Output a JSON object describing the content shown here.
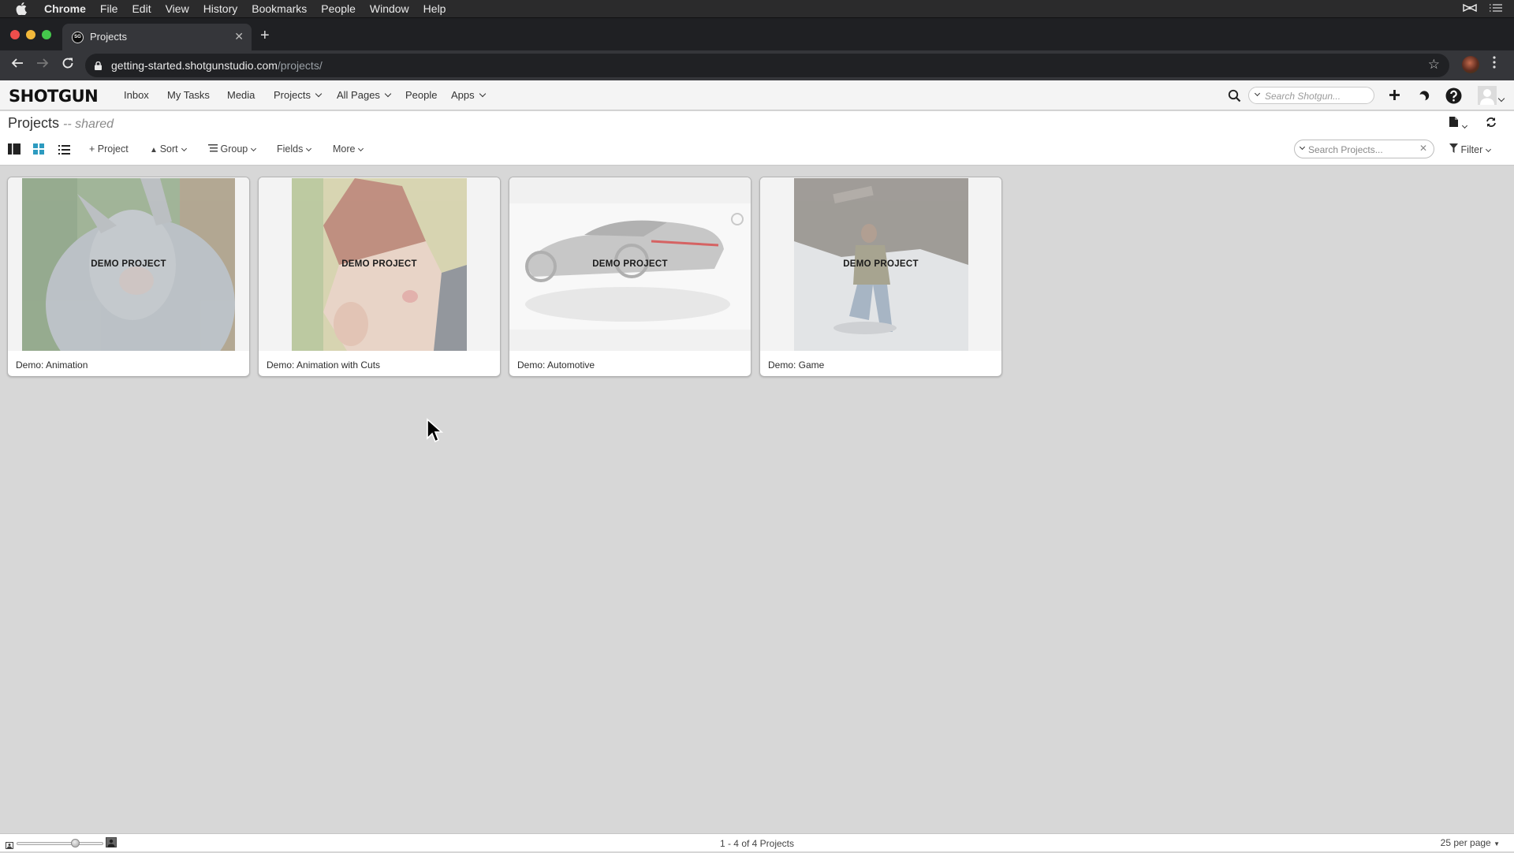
{
  "mac_menu": {
    "app_name": "Chrome",
    "items": [
      "File",
      "Edit",
      "View",
      "History",
      "Bookmarks",
      "People",
      "Window",
      "Help"
    ]
  },
  "browser": {
    "tab_title": "Projects",
    "favicon_text": "SG",
    "url_host": "getting-started.shotgunstudio.com",
    "url_path": "/projects/"
  },
  "header": {
    "logo": "SHOTGUN",
    "nav": [
      {
        "label": "Inbox",
        "dropdown": false
      },
      {
        "label": "My Tasks",
        "dropdown": false
      },
      {
        "label": "Media",
        "dropdown": false
      },
      {
        "label": "Projects",
        "dropdown": true
      },
      {
        "label": "All Pages",
        "dropdown": true
      },
      {
        "label": "People",
        "dropdown": false
      },
      {
        "label": "Apps",
        "dropdown": true
      }
    ],
    "search_placeholder": "Search Shotgun..."
  },
  "page": {
    "title": "Projects",
    "subtitle": "-- shared"
  },
  "toolbar": {
    "views": [
      "detail-view",
      "thumbnail-view",
      "list-view"
    ],
    "active_view": "thumbnail-view",
    "add_label": "Project",
    "sort_label": "Sort",
    "group_label": "Group",
    "fields_label": "Fields",
    "more_label": "More",
    "search_placeholder": "Search Projects...",
    "filter_label": "Filter",
    "accent_color": "#2d9bc0"
  },
  "projects": [
    {
      "name": "Demo: Animation",
      "badge": "DEMO PROJECT"
    },
    {
      "name": "Demo: Animation with Cuts",
      "badge": "DEMO PROJECT"
    },
    {
      "name": "Demo: Automotive",
      "badge": "DEMO PROJECT"
    },
    {
      "name": "Demo: Game",
      "badge": "DEMO PROJECT"
    }
  ],
  "status": {
    "count_text": "1 - 4 of 4 Projects",
    "per_page": "25 per page",
    "thumb_size_fraction": 0.7
  }
}
